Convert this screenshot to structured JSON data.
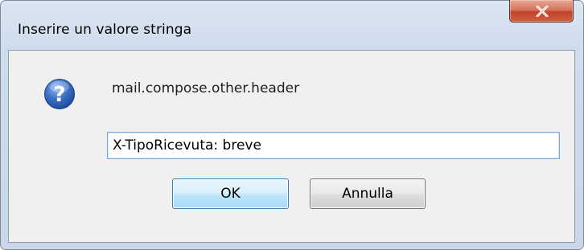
{
  "window": {
    "title": "Inserire un valore stringa"
  },
  "icons": {
    "dialog_icon": "question-icon",
    "close_icon": "close-icon"
  },
  "message": "mail.compose.other.header",
  "input": {
    "value": "X-TipoRicevuta: breve"
  },
  "buttons": {
    "ok_label": "OK",
    "cancel_label": "Annulla"
  },
  "colors": {
    "close_button": "#c1432a",
    "question_icon": "#2f62b6",
    "default_button_border": "#3c7fb1"
  }
}
